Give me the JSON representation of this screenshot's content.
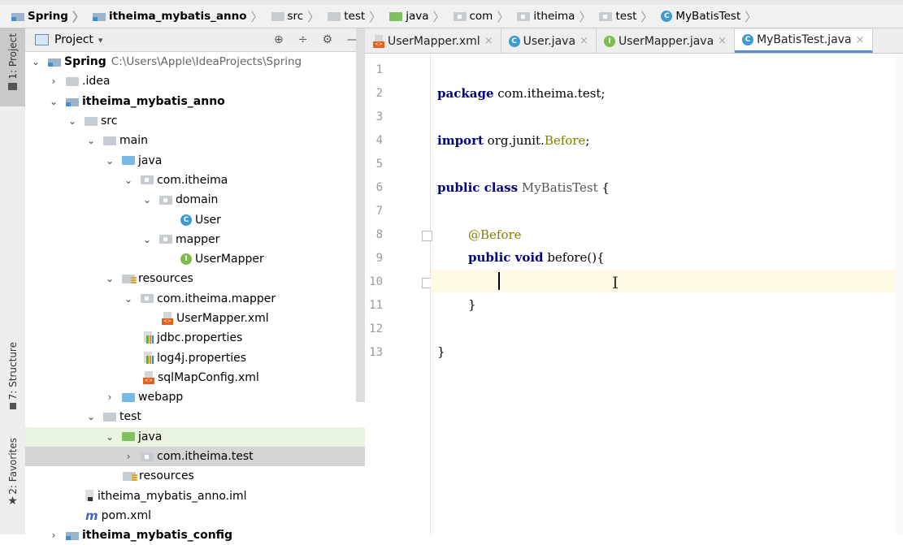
{
  "breadcrumb": [
    {
      "label": "Spring",
      "icon": "module-icon"
    },
    {
      "label": "itheima_mybatis_anno",
      "icon": "module-icon"
    },
    {
      "label": "src",
      "icon": "folder-icon"
    },
    {
      "label": "test",
      "icon": "folder-icon"
    },
    {
      "label": "java",
      "icon": "green-folder-icon"
    },
    {
      "label": "com",
      "icon": "package-icon"
    },
    {
      "label": "itheima",
      "icon": "package-icon"
    },
    {
      "label": "test",
      "icon": "package-icon"
    },
    {
      "label": "MyBatisTest",
      "icon": "class-icon"
    }
  ],
  "left_strip": {
    "project_tab": "1: Project",
    "structure_tab": "7: Structure",
    "favorites_tab": "2: Favorites"
  },
  "project_panel": {
    "title": "Project",
    "dropdown": "▾",
    "tools": [
      "⊕",
      "÷",
      "⚙",
      "—"
    ]
  },
  "tree": [
    {
      "label": "Spring",
      "path": "C:\\Users\\Apple\\IdeaProjects\\Spring",
      "arrow": "⌄"
    },
    {
      "label": ".idea",
      "arrow": "›"
    },
    {
      "label": "itheima_mybatis_anno",
      "arrow": "⌄"
    },
    {
      "label": "src",
      "arrow": "⌄"
    },
    {
      "label": "main",
      "arrow": "⌄"
    },
    {
      "label": "java",
      "arrow": "⌄"
    },
    {
      "label": "com.itheima",
      "arrow": "⌄"
    },
    {
      "label": "domain",
      "arrow": "⌄"
    },
    {
      "label": "User",
      "arrow": ""
    },
    {
      "label": "mapper",
      "arrow": "⌄"
    },
    {
      "label": "UserMapper",
      "arrow": ""
    },
    {
      "label": "resources",
      "arrow": "⌄"
    },
    {
      "label": "com.itheima.mapper",
      "arrow": "⌄"
    },
    {
      "label": "UserMapper.xml",
      "arrow": ""
    },
    {
      "label": "jdbc.properties",
      "arrow": ""
    },
    {
      "label": "log4j.properties",
      "arrow": ""
    },
    {
      "label": "sqlMapConfig.xml",
      "arrow": ""
    },
    {
      "label": "webapp",
      "arrow": "›"
    },
    {
      "label": "test",
      "arrow": "⌄"
    },
    {
      "label": "java",
      "arrow": "⌄"
    },
    {
      "label": "com.itheima.test",
      "arrow": "›"
    },
    {
      "label": "resources",
      "arrow": ""
    },
    {
      "label": "itheima_mybatis_anno.iml",
      "arrow": ""
    },
    {
      "label": "pom.xml",
      "arrow": ""
    },
    {
      "label": "itheima_mybatis_config",
      "arrow": "›"
    }
  ],
  "tabs": [
    {
      "label": "UserMapper.xml",
      "close": "×",
      "icon": "xml-file-icon"
    },
    {
      "label": "User.java",
      "close": "×",
      "icon": "class-icon"
    },
    {
      "label": "UserMapper.java",
      "close": "×",
      "icon": "interface-icon"
    },
    {
      "label": "MyBatisTest.java",
      "close": "×",
      "icon": "class-icon",
      "active": true
    }
  ],
  "line_numbers": [
    "1",
    "2",
    "3",
    "4",
    "5",
    "6",
    "7",
    "8",
    "9",
    "10",
    "11",
    "12",
    "13"
  ],
  "code": {
    "l1_kw": "package",
    "l1_rest": " com.itheima.test;",
    "l3_kw": "import",
    "l3_mid": " org.junit.",
    "l3_ann": "Before",
    "l3_end": ";",
    "l5_kw": "public class",
    "l5_name": " MyBatisTest",
    "l5_end": " {",
    "l7_ann": "@Before",
    "l8_kw": "public void",
    "l8_rest": " before(){",
    "l10": "}",
    "l12": "}"
  },
  "colors": {
    "keyword": "#000080",
    "annotation": "#808000",
    "current_line": "#fffae3",
    "active_tab_underline": "#5a8fd6",
    "selected_row": "#d5d5d5",
    "test_row": "#eaf5e1"
  }
}
